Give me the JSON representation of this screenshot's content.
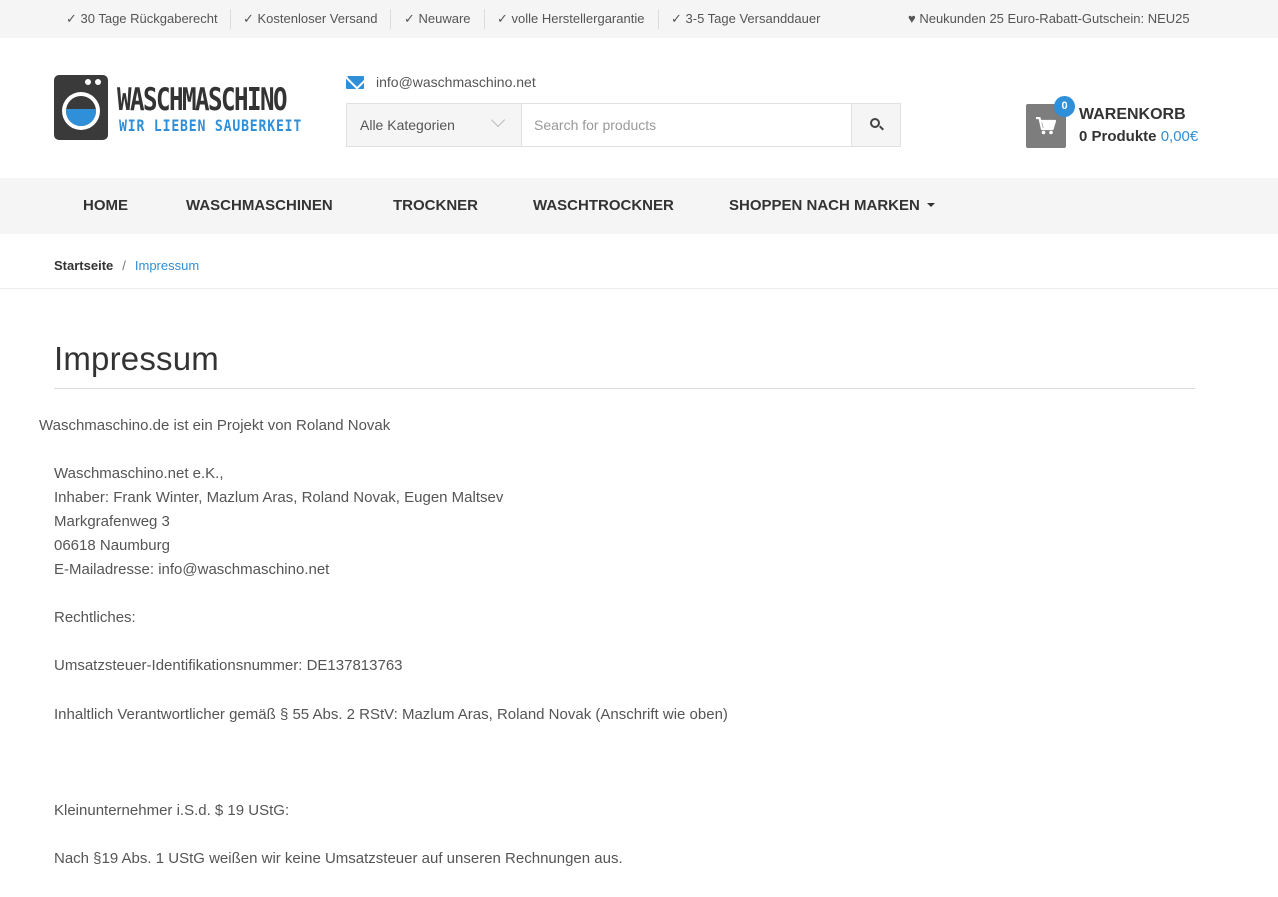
{
  "topbar": {
    "usps": [
      "✓ 30 Tage Rückgaberecht",
      "✓ Kostenloser Versand",
      "✓ Neuware",
      "✓ volle Herstellergarantie",
      "✓ 3-5 Tage Versanddauer"
    ],
    "promo": "♥ Neukunden 25 Euro-Rabatt-Gutschein: NEU25"
  },
  "header": {
    "logo_title": "WASCHMASCHINO",
    "logo_tagline": "WIR LIEBEN SAUBERKEIT",
    "email": "info@waschmaschino.net",
    "search": {
      "category": "Alle Kategorien",
      "placeholder": "Search for products"
    },
    "cart": {
      "count": "0",
      "title": "WARENKORB",
      "products": "0 Produkte",
      "price": "0,00€"
    }
  },
  "nav": {
    "items": [
      "HOME",
      "WASCHMASCHINEN",
      "TROCKNER",
      "WASCHTROCKNER",
      "SHOPPEN NACH MARKEN"
    ]
  },
  "breadcrumb": {
    "home": "Startseite",
    "separator": "/",
    "current": "Impressum"
  },
  "content": {
    "title": "Impressum",
    "paragraphs": [
      "Waschmaschino.de ist ein Projekt von Roland Novak",
      "Waschmaschino.net e.K.,",
      "Inhaber: Frank Winter, Mazlum Aras, Roland Novak, Eugen Maltsev",
      "Markgrafenweg 3",
      "06618 Naumburg",
      "E-Mailadresse: info@waschmaschino.net",
      "Rechtliches:",
      "Umsatzsteuer-Identifikationsnummer: DE137813763",
      "Inhaltlich Verantwortlicher gemäß § 55 Abs. 2 RStV: Mazlum Aras, Roland Novak (Anschrift wie oben)",
      "Kleinunternehmer i.S.d. $ 19 UStG:",
      "Nach §19 Abs. 1 UStG weißen wir keine Umsatzsteuer auf unseren Rechnungen aus."
    ]
  },
  "colors": {
    "accent": "#2f8fd8",
    "topbar_bg": "#f5f5f5",
    "nav_bg": "#f5f5f5",
    "text": "#555555",
    "heading": "#333333"
  }
}
